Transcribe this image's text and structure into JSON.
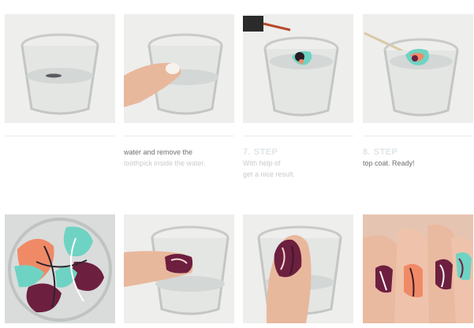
{
  "captions": [
    {
      "step": "",
      "lines": [
        "",
        ""
      ]
    },
    {
      "step": "",
      "lines": [
        "",
        "water and remove the",
        "toothpick inside the water."
      ]
    },
    {
      "step": "7. STEP",
      "lines": [
        "With help of",
        "get a nice result."
      ]
    },
    {
      "step": "8. STEP",
      "lines": [
        "",
        "top coat. Ready!"
      ]
    }
  ],
  "colors": {
    "background": "#ffffff",
    "water": "#dfe3e2",
    "nail_pink": "#6d1f3f",
    "nail_mint": "#6fd3c3",
    "nail_coral": "#f08a66"
  }
}
